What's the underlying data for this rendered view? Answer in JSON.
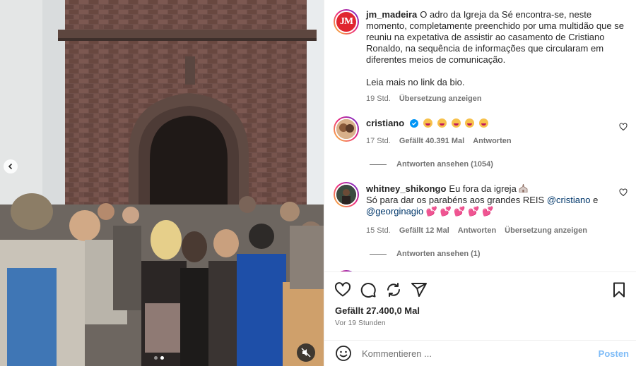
{
  "post": {
    "author": "jm_madeira",
    "caption": "O adro da Igreja da Sé encontra-se, neste momento, completamente preenchido por uma multidão que se reuniu na expetativa de assistir ao casamento de Cristiano Ronaldo, na sequência de informações que circularam em diferentes meios de comunicação.",
    "caption_extra": "Leia mais no link da bio.",
    "time": "19 Std.",
    "translate": "Übersetzung anzeigen",
    "avatar_text": "JM"
  },
  "comments": [
    {
      "user": "cristiano",
      "verified": true,
      "emoji_count": 5,
      "time": "17 Std.",
      "likes": "Gefällt 40.391 Mal",
      "reply": "Antworten",
      "view_replies": "Antworten ansehen (1054)"
    },
    {
      "user": "whitney_shikongo",
      "text_a": "Eu fora da igreja",
      "text_b": "Só para dar os parabéns aos grandes REIS",
      "mention_1": "@cristiano",
      "text_c": "e",
      "mention_2": "@georginagio",
      "hearts": "💕 💕 💕 💕 💕",
      "time": "15 Std.",
      "likes": "Gefällt 12 Mal",
      "reply": "Antworten",
      "translate": "Übersetzung anzeigen",
      "view_replies": "Antworten ansehen (1)"
    }
  ],
  "footer": {
    "likes": "Gefällt 27.400,0 Mal",
    "time": "Vor 19 Stunden",
    "comment_placeholder": "Kommentieren ...",
    "post_label": "Posten"
  },
  "media": {
    "slides": 2,
    "active_slide": 2
  },
  "colors": {
    "accent": "#0095f6",
    "post_disabled": "#7fbcf7",
    "brand_jm": "#e0252f",
    "muted_text": "#737373",
    "link": "#00376b"
  },
  "icons": [
    "heart-icon",
    "comment-icon",
    "share-icon",
    "send-icon",
    "bookmark-icon",
    "emoji-icon",
    "mute-icon",
    "chevron-left-icon",
    "verified-icon"
  ]
}
